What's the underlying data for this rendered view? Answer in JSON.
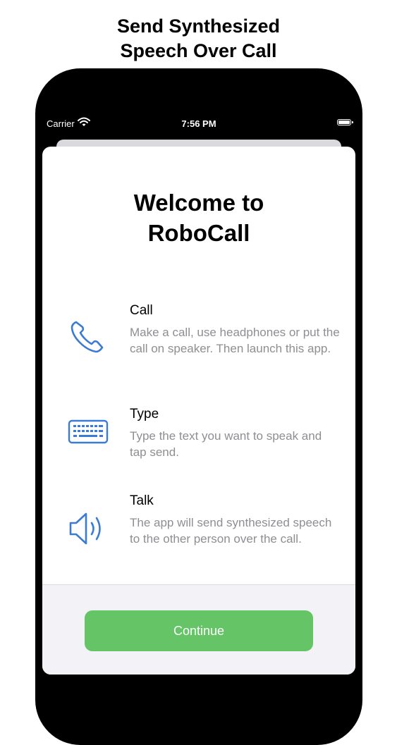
{
  "headline": {
    "line1": "Send Synthesized",
    "line2": "Speech Over Call"
  },
  "status_bar": {
    "carrier": "Carrier",
    "time": "7:56 PM",
    "icons": [
      "wifi-icon",
      "battery-icon"
    ]
  },
  "welcome": {
    "line1": "Welcome to",
    "line2": "RoboCall"
  },
  "features": [
    {
      "icon": "phone-icon",
      "title": "Call",
      "description": "Make a call, use headphones or put the call on speaker. Then launch this app."
    },
    {
      "icon": "keyboard-icon",
      "title": "Type",
      "description": "Type the text you want to speak and tap send."
    },
    {
      "icon": "speaker-icon",
      "title": "Talk",
      "description": "The app will send synthesized speech to the other person over the call."
    }
  ],
  "continue_button": {
    "label": "Continue"
  },
  "colors": {
    "accent": "#3a7bd5",
    "button": "#64c466",
    "secondary_text": "#8e8e93"
  }
}
